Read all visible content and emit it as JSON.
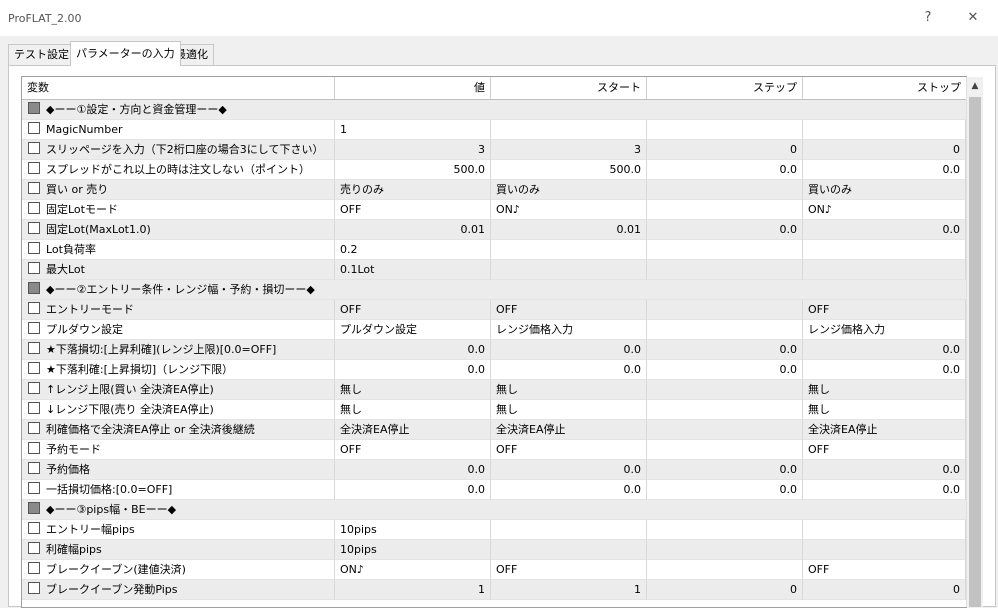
{
  "window": {
    "title": "ProFLAT_2.00",
    "help_glyph": "?",
    "close_glyph": "✕"
  },
  "tabs": [
    {
      "label": "テスト設定"
    },
    {
      "label": "パラメーターの入力"
    },
    {
      "label": "最適化"
    }
  ],
  "active_tab": 1,
  "columns": [
    "変数",
    "値",
    "スタート",
    "ステップ",
    "ストップ"
  ],
  "rows": [
    {
      "section": true,
      "name": "◆ーー①設定・方向と資金管理ーー◆",
      "value": "",
      "start": "",
      "step": "",
      "stop": ""
    },
    {
      "section": false,
      "name": "MagicNumber",
      "value": "1",
      "start": "",
      "step": "",
      "stop": "",
      "numeric": false
    },
    {
      "section": false,
      "name": "スリッページを入力（下2桁口座の場合3にして下さい）",
      "value": "3",
      "start": "3",
      "step": "0",
      "stop": "0",
      "numeric": true
    },
    {
      "section": false,
      "name": "スプレッドがこれ以上の時は注文しない（ポイント）",
      "value": "500.0",
      "start": "500.0",
      "step": "0.0",
      "stop": "0.0",
      "numeric": true
    },
    {
      "section": false,
      "name": "買い or 売り",
      "value": "売りのみ",
      "start": "買いのみ",
      "step": "",
      "stop": "買いのみ",
      "numeric": false
    },
    {
      "section": false,
      "name": "固定Lotモード",
      "value": "OFF",
      "start": "ON♪",
      "step": "",
      "stop": "ON♪",
      "numeric": false
    },
    {
      "section": false,
      "name": "固定Lot(MaxLot1.0)",
      "value": "0.01",
      "start": "0.01",
      "step": "0.0",
      "stop": "0.0",
      "numeric": true
    },
    {
      "section": false,
      "name": "Lot負荷率",
      "value": "0.2",
      "start": "",
      "step": "",
      "stop": "",
      "numeric": false
    },
    {
      "section": false,
      "name": "最大Lot",
      "value": "0.1Lot",
      "start": "",
      "step": "",
      "stop": "",
      "numeric": false
    },
    {
      "section": true,
      "name": "◆ーー②エントリー条件・レンジ幅・予約・損切ーー◆",
      "value": "",
      "start": "",
      "step": "",
      "stop": ""
    },
    {
      "section": false,
      "name": "エントリーモード",
      "value": "OFF",
      "start": "OFF",
      "step": "",
      "stop": "OFF",
      "numeric": false
    },
    {
      "section": false,
      "name": "プルダウン設定",
      "value": "プルダウン設定",
      "start": "レンジ価格入力",
      "step": "",
      "stop": "レンジ価格入力",
      "numeric": false
    },
    {
      "section": false,
      "name": "★下落損切:[上昇利確](レンジ上限)[0.0=OFF]",
      "value": "0.0",
      "start": "0.0",
      "step": "0.0",
      "stop": "0.0",
      "numeric": true
    },
    {
      "section": false,
      "name": "★下落利確:[上昇損切]（レンジ下限）",
      "value": "0.0",
      "start": "0.0",
      "step": "0.0",
      "stop": "0.0",
      "numeric": true
    },
    {
      "section": false,
      "name": "↑レンジ上限(買い 全決済EA停止)",
      "value": "無し",
      "start": "無し",
      "step": "",
      "stop": "無し",
      "numeric": false
    },
    {
      "section": false,
      "name": "↓レンジ下限(売り 全決済EA停止)",
      "value": "無し",
      "start": "無し",
      "step": "",
      "stop": "無し",
      "numeric": false
    },
    {
      "section": false,
      "name": "利確価格で全決済EA停止 or 全決済後継続",
      "value": "全決済EA停止",
      "start": "全決済EA停止",
      "step": "",
      "stop": "全決済EA停止",
      "numeric": false
    },
    {
      "section": false,
      "name": "予約モード",
      "value": "OFF",
      "start": "OFF",
      "step": "",
      "stop": "OFF",
      "numeric": false
    },
    {
      "section": false,
      "name": "予約価格",
      "value": "0.0",
      "start": "0.0",
      "step": "0.0",
      "stop": "0.0",
      "numeric": true
    },
    {
      "section": false,
      "name": "一括損切価格:[0.0=OFF]",
      "value": "0.0",
      "start": "0.0",
      "step": "0.0",
      "stop": "0.0",
      "numeric": true
    },
    {
      "section": true,
      "name": "◆ーー③pips幅・BEーー◆",
      "value": "",
      "start": "",
      "step": "",
      "stop": ""
    },
    {
      "section": false,
      "name": "エントリー幅pips",
      "value": "10pips",
      "start": "",
      "step": "",
      "stop": "",
      "numeric": false
    },
    {
      "section": false,
      "name": "利確幅pips",
      "value": "10pips",
      "start": "",
      "step": "",
      "stop": "",
      "numeric": false
    },
    {
      "section": false,
      "name": "ブレークイーブン(建値決済)",
      "value": "ON♪",
      "start": "OFF",
      "step": "",
      "stop": "OFF",
      "numeric": false
    },
    {
      "section": false,
      "name": "ブレークイーブン発動Pips",
      "value": "1",
      "start": "1",
      "step": "0",
      "stop": "0",
      "numeric": true
    }
  ],
  "scrollbar": {
    "up_glyph": "▲"
  }
}
